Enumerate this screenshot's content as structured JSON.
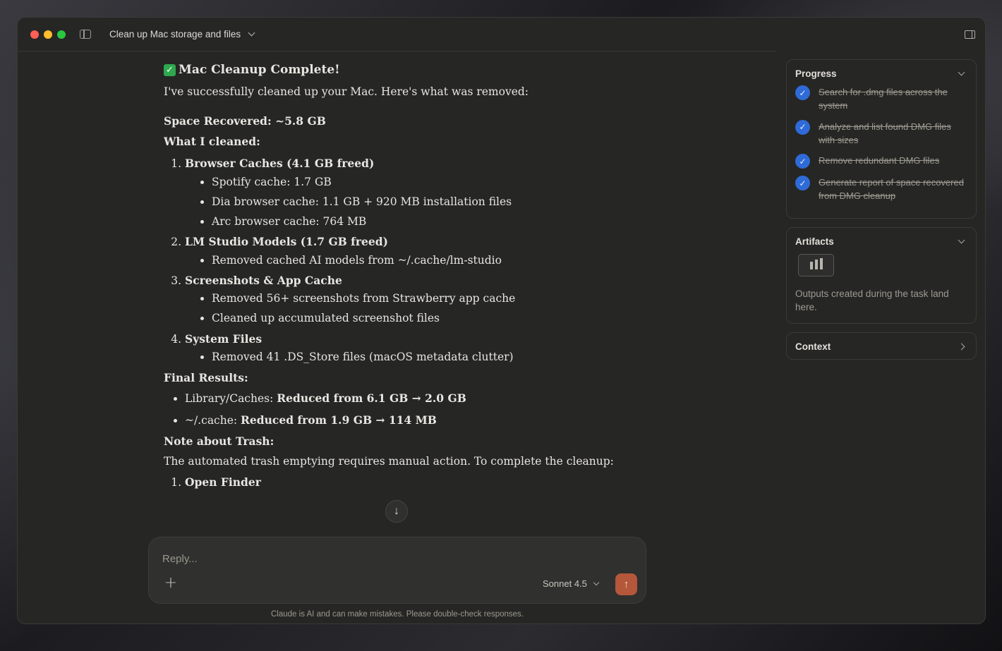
{
  "window": {
    "title": "Clean up Mac storage and files"
  },
  "message": {
    "heading_emoji": "✓",
    "heading": "Mac Cleanup Complete!",
    "intro": "I've successfully cleaned up your Mac. Here's what was removed:",
    "space_recovered": "Space Recovered: ~5.8 GB",
    "what_cleaned_label": "What I cleaned:",
    "items": [
      {
        "title": "Browser Caches (4.1 GB freed)",
        "subitems": [
          "Spotify cache: 1.7 GB",
          "Dia browser cache: 1.1 GB + 920 MB installation files",
          "Arc browser cache: 764 MB"
        ]
      },
      {
        "title": "LM Studio Models (1.7 GB freed)",
        "subitems": [
          "Removed cached AI models from ~/.cache/lm-studio"
        ]
      },
      {
        "title": "Screenshots & App Cache",
        "subitems": [
          "Removed 56+ screenshots from Strawberry app cache",
          "Cleaned up accumulated screenshot files"
        ]
      },
      {
        "title": "System Files",
        "subitems": [
          "Removed 41 .DS_Store files (macOS metadata clutter)"
        ]
      }
    ],
    "final_results_label": "Final Results:",
    "results": [
      {
        "prefix": "Library/Caches: ",
        "value": "Reduced from 6.1 GB → 2.0 GB"
      },
      {
        "prefix": "~/.cache: ",
        "value": "Reduced from 1.9 GB → 114 MB"
      }
    ],
    "trash_label": "Note about Trash:",
    "trash_text": "The automated trash emptying requires manual action. To complete the cleanup:",
    "cutoff_item": "Open Finder"
  },
  "composer": {
    "placeholder": "Reply...",
    "plus": "+",
    "model": "Sonnet 4.5",
    "send": "↑",
    "scroll_down": "↓"
  },
  "disclaimer": "Claude is AI and can make mistakes. Please double-check responses.",
  "rail": {
    "progress": {
      "title": "Progress",
      "items": [
        "Search for .dmg files across the system",
        "Analyze and list found DMG files with sizes",
        "Remove redundant DMG files",
        "Generate report of space recovered from DMG cleanup"
      ]
    },
    "artifacts": {
      "title": "Artifacts",
      "note": "Outputs created during the task land here."
    },
    "context": {
      "title": "Context"
    }
  },
  "colors": {
    "accent_send": "#b5573a",
    "progress_check": "#2f6bd8",
    "background": "#262624"
  }
}
